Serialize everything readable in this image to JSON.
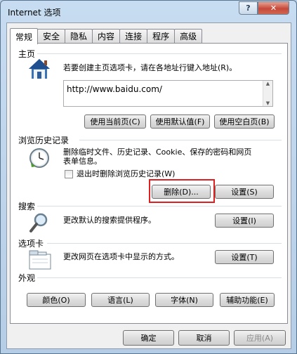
{
  "window": {
    "title": "Internet 选项",
    "help_label": "?",
    "close_label": "✕"
  },
  "tabs": [
    {
      "label": "常规"
    },
    {
      "label": "安全"
    },
    {
      "label": "隐私"
    },
    {
      "label": "内容"
    },
    {
      "label": "连接"
    },
    {
      "label": "程序"
    },
    {
      "label": "高级"
    }
  ],
  "homepage": {
    "section_label": "主页",
    "description": "若要创建主页选项卡，请在各地址行键入地址(R)。",
    "url_value": "http://www.baidu.com/",
    "use_current_label": "使用当前页(C)",
    "use_default_label": "使用默认值(F)",
    "use_blank_label": "使用空白页(B)"
  },
  "history": {
    "section_label": "浏览历史记录",
    "description_line1": "删除临时文件、历史记录、Cookie、保存的密码和网页",
    "description_line2": "表单信息。",
    "checkbox_label": "退出时删除浏览历史记录(W)",
    "delete_label": "删除(D)...",
    "settings_label": "设置(S)"
  },
  "search": {
    "section_label": "搜索",
    "description": "更改默认的搜索提供程序。",
    "settings_label": "设置(I)"
  },
  "tabs_section": {
    "section_label": "选项卡",
    "description": "更改网页在选项卡中显示的方式。",
    "settings_label": "设置(T)"
  },
  "appearance": {
    "section_label": "外观",
    "colors_label": "颜色(O)",
    "languages_label": "语言(L)",
    "fonts_label": "字体(N)",
    "accessibility_label": "辅助功能(E)"
  },
  "footer": {
    "ok_label": "确定",
    "cancel_label": "取消",
    "apply_label": "应用(A)"
  },
  "colors": {
    "highlight": "#e02020"
  }
}
